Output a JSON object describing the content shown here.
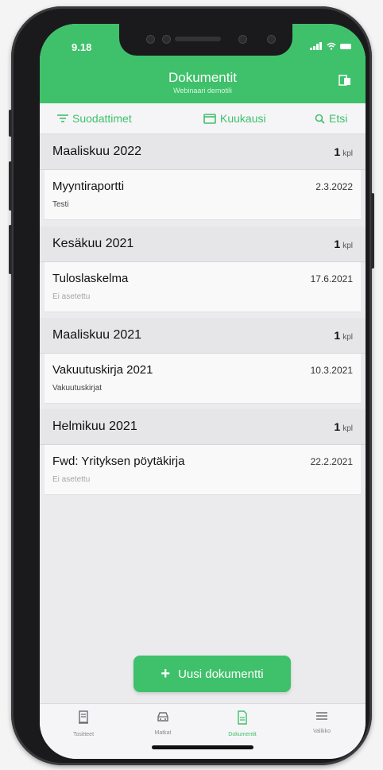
{
  "status_bar": {
    "time": "9.18",
    "icons": "..ıl ≋"
  },
  "header": {
    "title": "Dokumentit",
    "subtitle": "Webinaari demotili",
    "folder_icon": "folder-icon"
  },
  "toolbar": {
    "filters": "Suodattimet",
    "month": "Kuukausi",
    "search": "Etsi"
  },
  "sections": [
    {
      "title": "Maaliskuu 2022",
      "count": "1",
      "unit": "kpl",
      "doc": {
        "title": "Myyntiraportti",
        "date": "2.3.2022",
        "subtitle": "Testi",
        "muted": false
      }
    },
    {
      "title": "Kesäkuu 2021",
      "count": "1",
      "unit": "kpl",
      "doc": {
        "title": "Tuloslaskelma",
        "date": "17.6.2021",
        "subtitle": "Ei asetettu",
        "muted": true
      }
    },
    {
      "title": "Maaliskuu 2021",
      "count": "1",
      "unit": "kpl",
      "doc": {
        "title": "Vakuutuskirja 2021",
        "date": "10.3.2021",
        "subtitle": "Vakuutuskirjat",
        "muted": false
      }
    },
    {
      "title": "Helmikuu 2021",
      "count": "1",
      "unit": "kpl",
      "doc": {
        "title": "Fwd: Yrityksen pöytäkirja",
        "date": "22.2.2021",
        "subtitle": "Ei asetettu",
        "muted": true
      }
    }
  ],
  "new_document_button": {
    "plus": "+",
    "label": "Uusi dokumentti"
  },
  "tabbar": {
    "tabs": [
      {
        "label": "Tositteet",
        "icon": "receipt-icon"
      },
      {
        "label": "Matkat",
        "icon": "car-icon"
      },
      {
        "label": "Dokumentit",
        "icon": "document-icon",
        "active": true
      },
      {
        "label": "Valikko",
        "icon": "menu-icon"
      }
    ]
  },
  "colors": {
    "accent": "#3ec16a",
    "background": "#ebebed",
    "frame": "#1a1a1c"
  }
}
